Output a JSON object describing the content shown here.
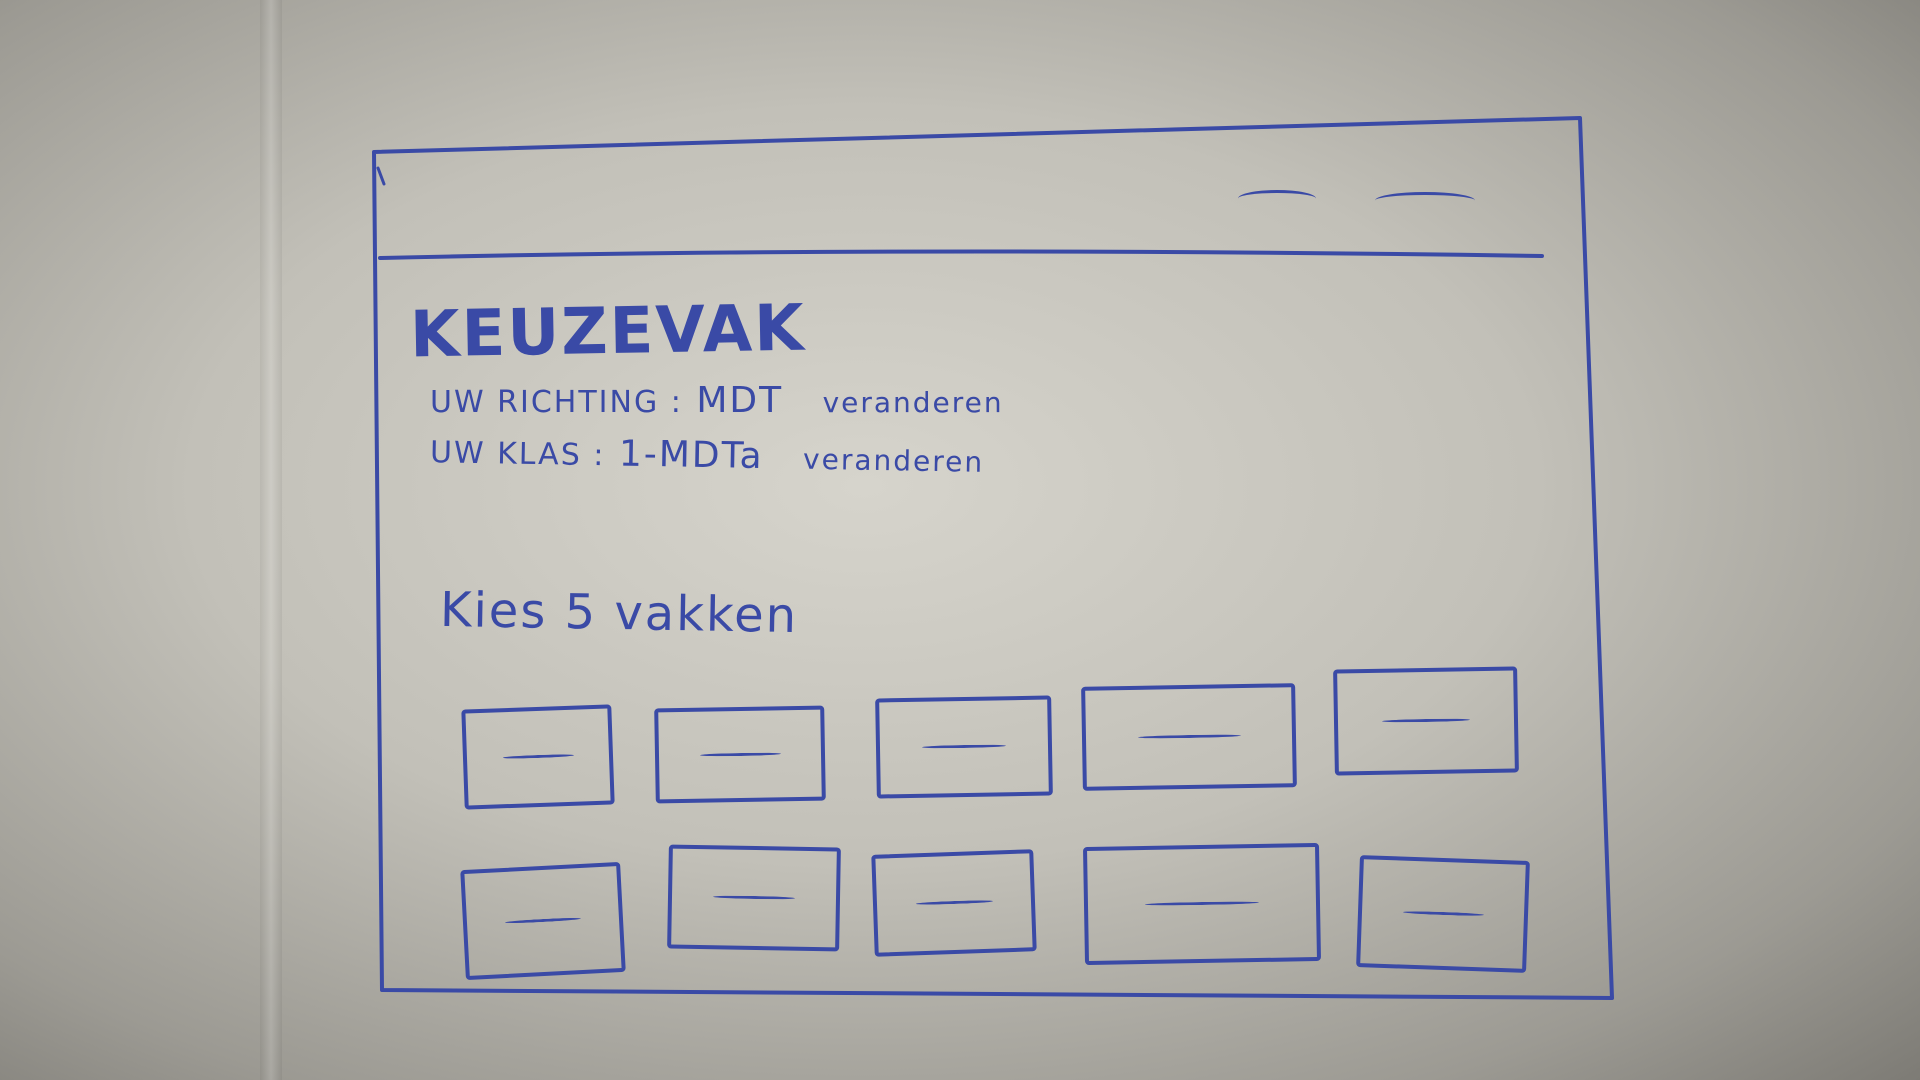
{
  "header": {
    "nav_links": [
      "~",
      "~"
    ]
  },
  "main": {
    "title": "KEUZEVAK",
    "richting": {
      "label": "UW RICHTING :",
      "value": "MDT",
      "edit": "veranderen"
    },
    "klas": {
      "label": "UW KLAS :",
      "value": "1-MDTa",
      "edit": "veranderen"
    },
    "prompt": "Kies 5 vakken",
    "course_cards": [
      {
        "label": "~"
      },
      {
        "label": "~"
      },
      {
        "label": "~"
      },
      {
        "label": "~"
      },
      {
        "label": "~"
      },
      {
        "label": "~"
      },
      {
        "label": "~"
      },
      {
        "label": "~"
      },
      {
        "label": "~"
      },
      {
        "label": "~"
      }
    ]
  },
  "colors": {
    "ink": "#3a4aa6",
    "paper": "#d6d4cc"
  }
}
